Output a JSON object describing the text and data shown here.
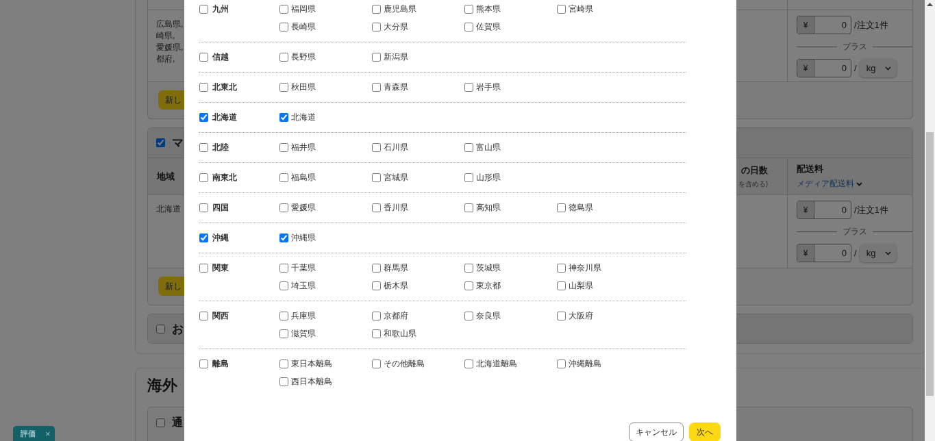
{
  "background": {
    "block_1": {
      "region_lines": [
        "広島県,",
        "崎県,",
        "愛媛県,",
        "都府,"
      ],
      "fee_per_order": {
        "currency": "¥",
        "value": "0",
        "unit": "/注文1件"
      },
      "plus_label": "プラス",
      "fee_per_weight": {
        "currency": "¥",
        "value": "0",
        "separator": "/",
        "unit": "kg"
      },
      "add_button": "新し"
    },
    "section_2": {
      "checked": true,
      "title": "マ",
      "columns": [
        {
          "label": "地域"
        },
        {
          "label": "の日数",
          "note": "を含める)"
        },
        {
          "label": "配送料",
          "note": "メディア配送料"
        }
      ],
      "rows": [
        {
          "region": "北海道",
          "fee_per_order": {
            "currency": "¥",
            "value": "0",
            "unit": "/注文1件"
          },
          "plus_label": "プラス",
          "fee_per_weight": {
            "currency": "¥",
            "value": "0",
            "separator": "/",
            "unit": "kg"
          }
        }
      ],
      "add_button": "新し"
    },
    "section_3": {
      "checked": false,
      "title": "お"
    },
    "overseas": {
      "heading": "海外",
      "option": {
        "checked": false,
        "label": "通"
      }
    }
  },
  "dialog": {
    "groups": [
      {
        "name": "九州",
        "checked": false,
        "prefectures": [
          {
            "name": "福岡県",
            "checked": false
          },
          {
            "name": "鹿児島県",
            "checked": false
          },
          {
            "name": "熊本県",
            "checked": false
          },
          {
            "name": "宮崎県",
            "checked": false
          },
          {
            "name": "長崎県",
            "checked": false
          },
          {
            "name": "大分県",
            "checked": false
          },
          {
            "name": "佐賀県",
            "checked": false
          }
        ]
      },
      {
        "name": "信越",
        "checked": false,
        "prefectures": [
          {
            "name": "長野県",
            "checked": false
          },
          {
            "name": "新潟県",
            "checked": false
          }
        ]
      },
      {
        "name": "北東北",
        "checked": false,
        "prefectures": [
          {
            "name": "秋田県",
            "checked": false
          },
          {
            "name": "青森県",
            "checked": false
          },
          {
            "name": "岩手県",
            "checked": false
          }
        ]
      },
      {
        "name": "北海道",
        "checked": true,
        "prefectures": [
          {
            "name": "北海道",
            "checked": true
          }
        ]
      },
      {
        "name": "北陸",
        "checked": false,
        "prefectures": [
          {
            "name": "福井県",
            "checked": false
          },
          {
            "name": "石川県",
            "checked": false
          },
          {
            "name": "富山県",
            "checked": false
          }
        ]
      },
      {
        "name": "南東北",
        "checked": false,
        "prefectures": [
          {
            "name": "福島県",
            "checked": false
          },
          {
            "name": "宮城県",
            "checked": false
          },
          {
            "name": "山形県",
            "checked": false
          }
        ]
      },
      {
        "name": "四国",
        "checked": false,
        "prefectures": [
          {
            "name": "愛媛県",
            "checked": false
          },
          {
            "name": "香川県",
            "checked": false
          },
          {
            "name": "高知県",
            "checked": false
          },
          {
            "name": "徳島県",
            "checked": false
          }
        ]
      },
      {
        "name": "沖縄",
        "checked": true,
        "prefectures": [
          {
            "name": "沖縄県",
            "checked": true
          }
        ]
      },
      {
        "name": "関東",
        "checked": false,
        "prefectures": [
          {
            "name": "千葉県",
            "checked": false
          },
          {
            "name": "群馬県",
            "checked": false
          },
          {
            "name": "茨城県",
            "checked": false
          },
          {
            "name": "神奈川県",
            "checked": false
          },
          {
            "name": "埼玉県",
            "checked": false
          },
          {
            "name": "栃木県",
            "checked": false
          },
          {
            "name": "東京都",
            "checked": false
          },
          {
            "name": "山梨県",
            "checked": false
          }
        ]
      },
      {
        "name": "関西",
        "checked": false,
        "prefectures": [
          {
            "name": "兵庫県",
            "checked": false
          },
          {
            "name": "京都府",
            "checked": false
          },
          {
            "name": "奈良県",
            "checked": false
          },
          {
            "name": "大阪府",
            "checked": false
          },
          {
            "name": "滋賀県",
            "checked": false
          },
          {
            "name": "和歌山県",
            "checked": false
          }
        ]
      },
      {
        "name": "離島",
        "checked": false,
        "prefectures": [
          {
            "name": "東日本離島",
            "checked": false
          },
          {
            "name": "その他離島",
            "checked": false
          },
          {
            "name": "北海道離島",
            "checked": false
          },
          {
            "name": "沖縄離島",
            "checked": false
          },
          {
            "name": "西日本離島",
            "checked": false
          }
        ]
      }
    ],
    "buttons": [
      {
        "label": "キャンセル",
        "kind": "secondary"
      },
      {
        "label": "次へ",
        "kind": "primary"
      }
    ]
  },
  "feedback_tab": {
    "label": "評価",
    "close": "×"
  }
}
